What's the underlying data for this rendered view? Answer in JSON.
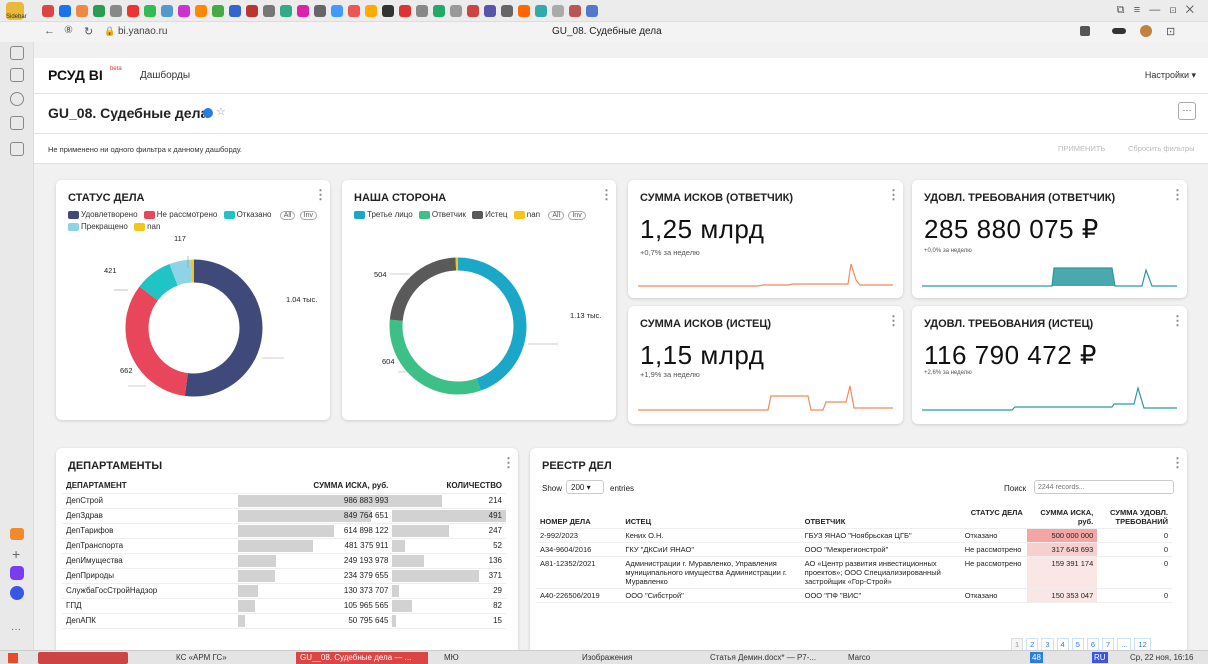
{
  "browser": {
    "address": "bi.yanao.ru",
    "tab_title": "GU_08. Судебные дела"
  },
  "app": {
    "logo": "РСУД BI",
    "logo_badge": "beta",
    "nav_dashboards": "Дашборды",
    "settings": "Настройки ▾",
    "dashboard_title": "GU_08. Судебные дела",
    "filter_message": "Не применено ни одного фильтра к данному дашборду.",
    "apply_button": "ПРИМЕНИТЬ",
    "reset_button": "Сбросить фильтры",
    "more_button": "···"
  },
  "status_card": {
    "title": "СТАТУС ДЕЛА",
    "legend": [
      {
        "label": "Удовлетворено",
        "color": "#3f4a7a"
      },
      {
        "label": "Не рассмотрено",
        "color": "#e8465a"
      },
      {
        "label": "Отказано",
        "color": "#20c4c4"
      },
      {
        "label": "Прекращено",
        "color": "#8fd3e6"
      },
      {
        "label": "nan",
        "color": "#f5c518"
      }
    ],
    "pill_all": "All",
    "pill_inv": "Inv",
    "labels": {
      "a": "1.04 тыс.",
      "b": "662",
      "c": "421",
      "d": "117"
    }
  },
  "side_card": {
    "title": "НАША СТОРОНА",
    "legend": [
      {
        "label": "Третье лицо",
        "color": "#1aa7c8"
      },
      {
        "label": "Ответчик",
        "color": "#3dbf88"
      },
      {
        "label": "Истец",
        "color": "#5a5a5a"
      },
      {
        "label": "nan",
        "color": "#f5c518"
      }
    ],
    "pill_all": "All",
    "pill_inv": "Inv",
    "labels": {
      "a": "1.13 тыс.",
      "b": "604",
      "c": "504"
    }
  },
  "kpi": [
    {
      "title": "СУММА ИСКОВ (ОТВЕТЧИК)",
      "value": "1,25 млрд",
      "change": "+0,7% за неделю",
      "color": "#f08a5d"
    },
    {
      "title": "УДОВЛ. ТРЕБОВАНИЯ (ОТВЕТЧИК)",
      "value": "285 880 075 ₽",
      "change": "+0,0% за неделю",
      "color": "#2a9aa0"
    },
    {
      "title": "СУММА ИСКОВ (ИСТЕЦ)",
      "value": "1,15 млрд",
      "change": "+1,9% за неделю",
      "color": "#f08a5d"
    },
    {
      "title": "УДОВЛ. ТРЕБОВАНИЯ (ИСТЕЦ)",
      "value": "116 790 472 ₽",
      "change": "+2,6% за неделю",
      "color": "#2a9aa0"
    }
  ],
  "departments": {
    "title": "ДЕПАРТАМЕНТЫ",
    "columns": [
      "ДЕПАРТАМЕНТ",
      "СУММА ИСКА, руб.",
      "КОЛИЧЕСТВО"
    ],
    "rows": [
      {
        "name": "ДепСтрой",
        "sum": "986 883 993",
        "sum_frac": 1.0,
        "count": "214",
        "count_frac": 0.44
      },
      {
        "name": "ДепЗдрав",
        "sum": "849 764 651",
        "sum_frac": 0.86,
        "count": "491",
        "count_frac": 1.0
      },
      {
        "name": "ДепТарифов",
        "sum": "614 898 122",
        "sum_frac": 0.62,
        "count": "247",
        "count_frac": 0.5
      },
      {
        "name": "ДепТранспорта",
        "sum": "481 375 911",
        "sum_frac": 0.49,
        "count": "52",
        "count_frac": 0.11
      },
      {
        "name": "ДепИмущества",
        "sum": "249 193 978",
        "sum_frac": 0.25,
        "count": "136",
        "count_frac": 0.28
      },
      {
        "name": "ДепПрироды",
        "sum": "234 379 655",
        "sum_frac": 0.24,
        "count": "371",
        "count_frac": 0.76
      },
      {
        "name": "СлужбаГосСтройНадзор",
        "sum": "130 373 707",
        "sum_frac": 0.13,
        "count": "29",
        "count_frac": 0.06
      },
      {
        "name": "ГПД",
        "sum": "105 965 565",
        "sum_frac": 0.11,
        "count": "82",
        "count_frac": 0.17
      },
      {
        "name": "ДепАПК",
        "sum": "50 795 645",
        "sum_frac": 0.05,
        "count": "15",
        "count_frac": 0.03
      }
    ]
  },
  "registry": {
    "title": "РЕЕСТР ДЕЛ",
    "show": "Show",
    "entries_value": "200",
    "entries": "entries",
    "search_label": "Поиск",
    "search_placeholder": "2244 records...",
    "columns": [
      "НОМЕР ДЕЛА",
      "ИСТЕЦ",
      "ОТВЕТЧИК",
      "СТАТУС ДЕЛА",
      "СУММА ИСКА, руб.",
      "СУММА УДОВЛ. ТРЕБОВАНИЙ"
    ],
    "rows": [
      {
        "num": "2-992/2023",
        "plaintiff": "Кених О.Н.",
        "defendant": "ГБУЗ ЯНАО \"Ноябрьская ЦГБ\"",
        "status": "Отказано",
        "sum": "500 000 000",
        "sat": "0"
      },
      {
        "num": "А34-9604/2016",
        "plaintiff": "ГКУ \"ДКСиИ ЯНАО\"",
        "defendant": "ООО \"Межрегионстрой\"",
        "status": "Не рассмотрено",
        "sum": "317 643 693",
        "sat": "0"
      },
      {
        "num": "А81-12352/2021",
        "plaintiff": "Администрации г. Муравленко, Управления муниципального имущества Администрации г. Муравленко",
        "defendant": "АО «Центр развития инвестиционных проектов»; ООО Специализированный застройщик «Гор-Строй»",
        "status": "Не рассмотрено",
        "sum": "159 391 174",
        "sat": "0"
      },
      {
        "num": "А40-226506/2019",
        "plaintiff": "ООО \"Сибстрой\"",
        "defendant": "ООО \"ПФ \"ВИС\"",
        "status": "Отказано",
        "sum": "150 353 047",
        "sat": "0"
      }
    ],
    "pages": [
      "1",
      "2",
      "3",
      "4",
      "5",
      "6",
      "7",
      "...",
      "12"
    ]
  },
  "taskbar": {
    "items": [
      "КС «АРМ ГС»",
      "GU__08. Судебные дела — ...",
      "МЮ",
      "Изображения",
      "Статья Демин.docx* — P7-...",
      "Marco"
    ],
    "clock": "Ср, 22 ноя, 16:16",
    "lang": "RU",
    "badge": "48"
  }
}
